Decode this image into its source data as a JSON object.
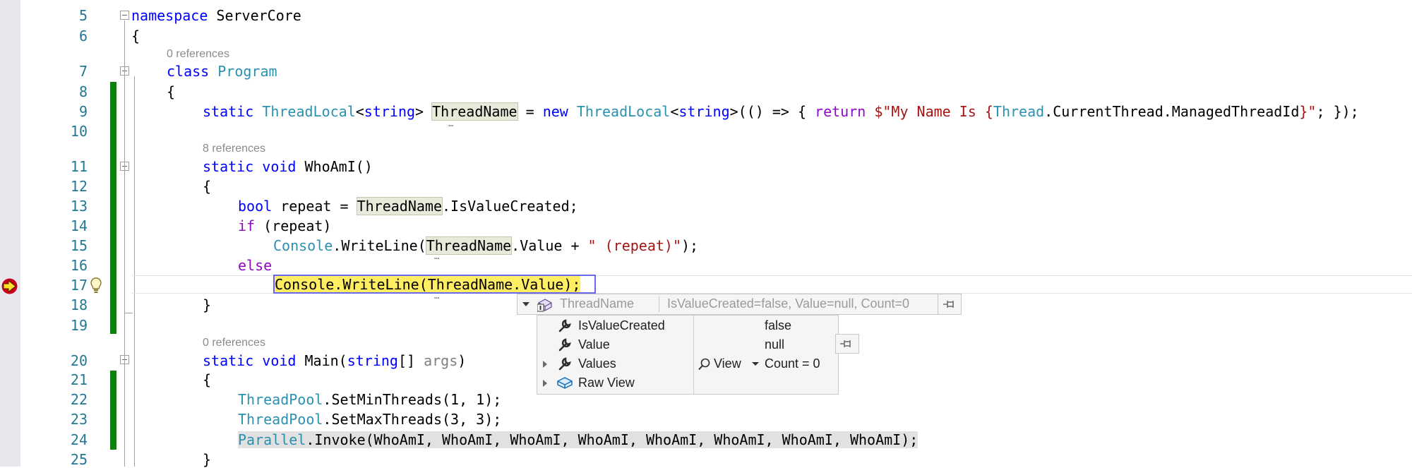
{
  "editor": {
    "line_numbers": [
      "5",
      "6",
      "7",
      "8",
      "9",
      "10",
      "11",
      "12",
      "13",
      "14",
      "15",
      "16",
      "17",
      "18",
      "19",
      "20",
      "21",
      "22",
      "23",
      "24",
      "25"
    ],
    "codelens": {
      "program_refs": "0 references",
      "whoami_refs": "8 references",
      "main_refs": "0 references"
    },
    "lines": {
      "l5_kw": "namespace",
      "l5_name": " ServerCore",
      "l6": "{",
      "l7_kw": "class",
      "l7_ty": "Program",
      "l8": "{",
      "l9": {
        "static": "static ",
        "tl1": "ThreadLocal",
        "lt1": "<",
        "str1": "string",
        "gt1": "> ",
        "name": "ThreadName",
        "eq": " = ",
        "new": "new ",
        "tl2": "ThreadLocal",
        "lt2": "<",
        "str2": "string",
        "gt2": ">(() => { ",
        "ret": "return",
        "sp": " ",
        "s1": "$\"My Name Is {",
        "thread": "Thread",
        "mid": ".CurrentThread.ManagedThreadId",
        "s2": "}\"",
        "end": "; });"
      },
      "l11_kw": "static void",
      "l11_rest": " WhoAmI()",
      "l12": "{",
      "l13": {
        "kw": "bool",
        "a": " repeat = ",
        "name": "ThreadName",
        "b": ".IsValueCreated;"
      },
      "l14": {
        "kw": "if",
        "rest": " (repeat)"
      },
      "l15": {
        "ty": "Console",
        "a": ".WriteLine(",
        "name": "ThreadName",
        "b": ".Value + ",
        "str": "\" (repeat)\"",
        "c": ");"
      },
      "l16": "else",
      "l17": "Console.WriteLine(ThreadName.Value);",
      "l18": "}",
      "l20": {
        "kw1": "static void",
        "a": " Main(",
        "kw2": "string",
        "b": "[] ",
        "args": "args",
        "c": ")"
      },
      "l21": "{",
      "l22": {
        "ty": "ThreadPool",
        "rest": ".SetMinThreads(1, 1);"
      },
      "l23": {
        "ty": "ThreadPool",
        "rest": ".SetMaxThreads(3, 3);"
      },
      "l24": {
        "ty": "Parallel",
        "rest": ".Invoke(WhoAmI, WhoAmI, WhoAmI, WhoAmI, WhoAmI, WhoAmI, WhoAmI, WhoAmI);"
      },
      "l25": "}"
    }
  },
  "datatip": {
    "header_name": "ThreadName",
    "header_value": "IsValueCreated=false, Value=null, Count=0",
    "rows": [
      {
        "name": "IsValueCreated",
        "value": "false"
      },
      {
        "name": "Value",
        "value": "null"
      },
      {
        "name": "Values",
        "view": "View",
        "value": "Count = 0"
      },
      {
        "name": "Raw View"
      }
    ]
  },
  "colors": {
    "keyword": "#0000ff",
    "type": "#2b91af",
    "control": "#8f08c4",
    "string": "#a31515",
    "line_number": "#237893",
    "current_statement": "#ffee62",
    "change_bar": "#108010"
  }
}
